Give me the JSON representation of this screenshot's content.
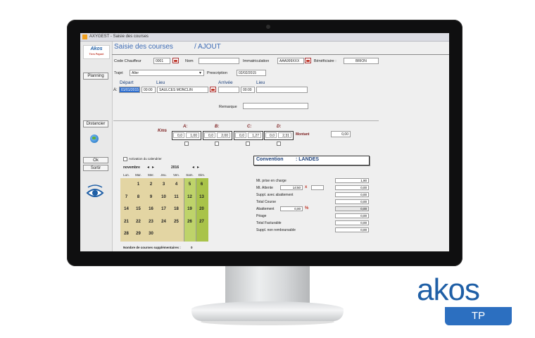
{
  "window": {
    "title": "AXYGEST - Saisie des courses"
  },
  "header": {
    "title": "Saisie des courses",
    "mode": "/ AJOUT"
  },
  "sidebar": {
    "logo": {
      "brand": "Akos",
      "tagline": "Tiers Payant"
    },
    "planning_label": "Planning",
    "distancier_label": "Distancier",
    "ok_label": "Ok",
    "sortir_label": "Sortir"
  },
  "form": {
    "code_chauffeur": {
      "label": "Code Chauffeur",
      "value": "0001"
    },
    "nom": {
      "label": "Nom",
      "value": ""
    },
    "immatriculation": {
      "label": "Immatriculation",
      "value": "AAA999XXX"
    },
    "beneficiaire": {
      "label": "Bénéficiaire :",
      "value": "BRION"
    },
    "trajet": {
      "label": "Trajet",
      "value": "Aller"
    },
    "prescription": {
      "label": "Prescription",
      "value": "02/02/2015"
    },
    "depart_header": "Départ",
    "lieu_header": "Lieu",
    "arrivee_header": "Arrivée",
    "lieu2_header": "Lieu",
    "row_label": "A:",
    "depart_date": "01/01/2015",
    "depart_time": "00:00",
    "depart_lieu": "SAULCES MONCLIN",
    "arrivee_time": "00:00",
    "remarque": {
      "label": "Remarque",
      "value": ""
    }
  },
  "kms": {
    "label": "Kms",
    "montant_label": "Montant",
    "montant_value": "0,00",
    "columns": [
      {
        "label": "A:",
        "a": "0,0",
        "b": "1,00"
      },
      {
        "label": "B:",
        "a": "0,0",
        "b": "2,00"
      },
      {
        "label": "C:",
        "a": "0,0",
        "b": "1,27"
      },
      {
        "label": "D:",
        "a": "0,0",
        "b": "2,31"
      }
    ]
  },
  "calendar": {
    "activation_label": "Activation du calendrier",
    "month": "novembre",
    "year": "2016",
    "weekdays": [
      "Lun.",
      "Mar.",
      "Mer.",
      "Jeu.",
      "Ven.",
      "Sam.",
      "Dim."
    ],
    "days": [
      [
        "",
        "1",
        "2",
        "3",
        "4",
        "5",
        "6"
      ],
      [
        "7",
        "8",
        "9",
        "10",
        "11",
        "12",
        "13"
      ],
      [
        "14",
        "15",
        "16",
        "17",
        "18",
        "19",
        "20"
      ],
      [
        "21",
        "22",
        "23",
        "24",
        "25",
        "26",
        "27"
      ],
      [
        "28",
        "29",
        "30",
        "",
        "",
        "",
        ""
      ]
    ],
    "footer_label": "Nombre de courses supplémentaires :",
    "footer_value": "0"
  },
  "convention": {
    "label": "Convention",
    "value": ": LANDES"
  },
  "totals": {
    "prise_en_charge": {
      "label": "Mt. prise en charge",
      "value": "1,90"
    },
    "attente": {
      "label": "Mt. Attente",
      "time": "14:50",
      "mult": "x",
      "factor": "",
      "value": "0,00"
    },
    "suppl_abattement": {
      "label": "Suppl. avec abattement",
      "value": "0,00"
    },
    "total_course": {
      "label": "Total Course",
      "value": "0,00"
    },
    "abattement": {
      "label": "Abattement",
      "pct": "0,00",
      "pct_sign": "%",
      "value": "0,00"
    },
    "peage": {
      "label": "Péage",
      "value": "0,00"
    },
    "total_facturable": {
      "label": "Total Facturable",
      "value": "0,00"
    },
    "suppl_non_remb": {
      "label": "Suppl. non remboursable",
      "value": "0,00"
    }
  },
  "brand_logo": {
    "name": "akos",
    "badge": "TP"
  },
  "colors": {
    "accent": "#3c6bb5",
    "brand_blue": "#1f5fa6",
    "calendar_bg": "#e3d5a3",
    "weekend_bg": "#bed36a",
    "kms_red": "#7a1b1b"
  }
}
